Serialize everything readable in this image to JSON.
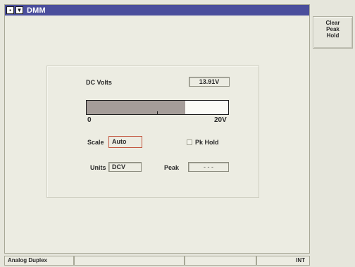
{
  "window": {
    "title": "DMM",
    "icons": [
      "window-menu-icon",
      "minimize-arrow-icon"
    ]
  },
  "meter": {
    "mode_label": "DC Volts",
    "reading": "13.91V",
    "bar": {
      "fill_fraction": 0.6955,
      "min_label": "0",
      "max_label": "20V"
    },
    "scale_label": "Scale",
    "scale_value": "Auto",
    "pk_hold_label": "Pk Hold",
    "pk_hold_checked": false,
    "units_label": "Units",
    "units_value": "DCV",
    "peak_label": "Peak",
    "peak_value": "- - -"
  },
  "side_buttons": [
    {
      "label": "Clear\nPeak\nHold"
    }
  ],
  "status": {
    "mode": "Analog Duplex",
    "cell2": "",
    "cell3": "",
    "ref": "INT"
  },
  "colors": {
    "title_bar": "#4a4e9c",
    "background": "#e6e6dc",
    "bar_fill": "#a59d99",
    "scale_focus": "#c2543d"
  }
}
